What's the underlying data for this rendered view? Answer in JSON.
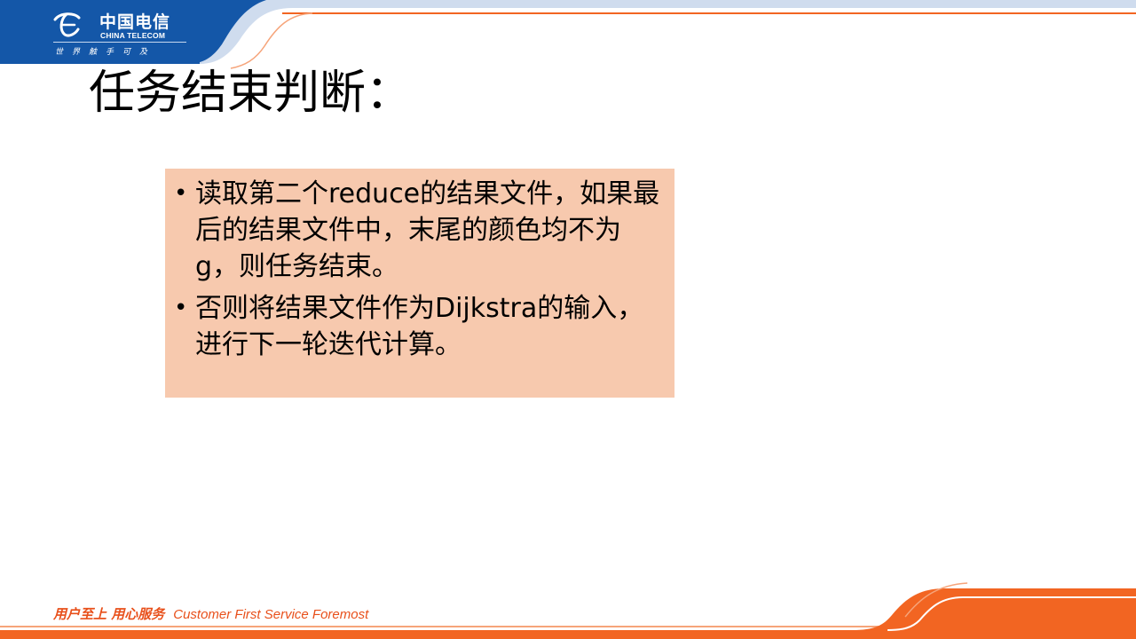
{
  "header": {
    "logo_cn": "中国电信",
    "logo_en": "CHINA TELECOM",
    "logo_slogan": "世界触手可及",
    "logo_icon": "china-telecom-logo-icon",
    "brand_blue": "#1457a8",
    "accent_orange": "#f26522"
  },
  "slide": {
    "title": "任务结束判断：",
    "box_color": "#f7c9ae",
    "bullets": [
      {
        "marker": "•",
        "text": "读取第二个reduce的结果文件，如果最后的结果文件中，末尾的颜色均不为g，则任务结束。"
      },
      {
        "marker": "•",
        "text": "否则将结果文件作为Dijkstra的输入，进行下一轮迭代计算。"
      }
    ]
  },
  "footer": {
    "slogan_cn": "用户至上  用心服务",
    "slogan_en": "Customer First Service Foremost"
  }
}
